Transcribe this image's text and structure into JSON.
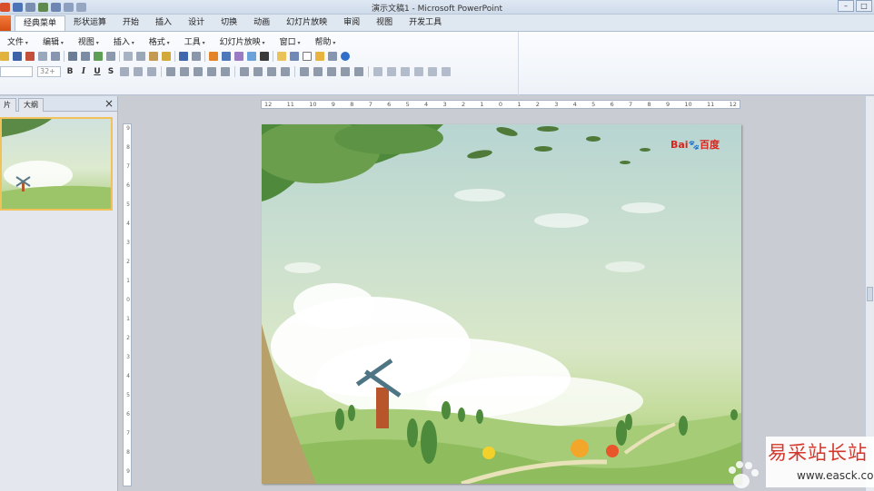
{
  "window": {
    "title": "演示文稿1 - Microsoft PowerPoint",
    "controls": {
      "minimize": "–",
      "maximize": "□"
    }
  },
  "ribbon_tabs": [
    {
      "label": "经典菜单",
      "active": true
    },
    {
      "label": "形状运算"
    },
    {
      "label": "开始"
    },
    {
      "label": "插入"
    },
    {
      "label": "设计"
    },
    {
      "label": "切换"
    },
    {
      "label": "动画"
    },
    {
      "label": "幻灯片放映"
    },
    {
      "label": "审阅"
    },
    {
      "label": "视图"
    },
    {
      "label": "开发工具"
    }
  ],
  "menus": [
    "文件",
    "编辑",
    "视图",
    "插入",
    "格式",
    "工具",
    "幻灯片放映",
    "窗口",
    "帮助"
  ],
  "format_toolbar": {
    "font_size": "32+",
    "bold": "B",
    "italic": "I",
    "underline": "U",
    "strike": "S"
  },
  "panel": {
    "tab_slides": "片",
    "tab_outline": "大纲",
    "close": "×"
  },
  "ruler": {
    "h_ticks": [
      "12",
      "11",
      "10",
      "9",
      "8",
      "7",
      "6",
      "5",
      "4",
      "3",
      "2",
      "1",
      "0",
      "1",
      "2",
      "3",
      "4",
      "5",
      "6",
      "7",
      "8",
      "9",
      "10",
      "11",
      "12"
    ],
    "v_ticks": [
      "9",
      "8",
      "7",
      "6",
      "5",
      "4",
      "3",
      "2",
      "1",
      "0",
      "1",
      "2",
      "3",
      "4",
      "5",
      "6",
      "7",
      "8",
      "9"
    ]
  },
  "slide": {
    "brand_text": "Bai",
    "brand_cn": "百度"
  },
  "watermark": {
    "text": "易采站长站",
    "url": "www.easck.com"
  },
  "colors": {
    "accent": "#2b579a",
    "file_tab": "#e0581c",
    "brand_red": "#d9251d"
  }
}
